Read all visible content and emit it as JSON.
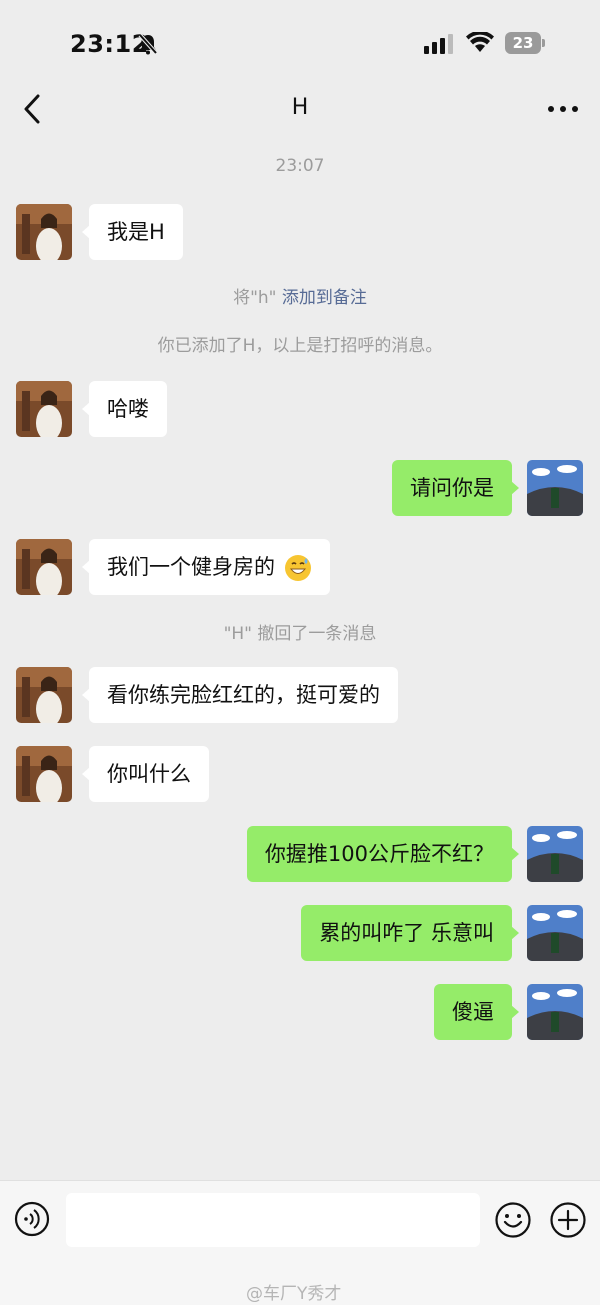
{
  "status_bar": {
    "time": "23:12",
    "battery": "23"
  },
  "header": {
    "title": "H"
  },
  "chat": {
    "timestamp": "23:07",
    "remark_prefix": "将\"h\"",
    "remark_link": "添加到备注",
    "added_notice": "你已添加了H，以上是打招呼的消息。",
    "recall_notice": "\"H\" 撤回了一条消息",
    "messages": [
      {
        "side": "in",
        "text": "我是H"
      },
      {
        "side": "in",
        "text": "哈喽"
      },
      {
        "side": "out",
        "text": "请问你是"
      },
      {
        "side": "in",
        "text": "我们一个健身房的",
        "emoji": "grinning-sweat-emoji"
      },
      {
        "side": "in",
        "text": "看你练完脸红红的，挺可爱的"
      },
      {
        "side": "in",
        "text": "你叫什么"
      },
      {
        "side": "out",
        "text": "你握推100公斤脸不红？"
      },
      {
        "side": "out",
        "text": "累的叫咋了 乐意叫"
      },
      {
        "side": "out",
        "text": "傻逼"
      }
    ]
  },
  "input": {
    "placeholder": ""
  },
  "watermark": "@车厂Y秀才",
  "colors": {
    "background": "#ededed",
    "incoming_bubble": "#ffffff",
    "outgoing_bubble": "#95ec69",
    "link": "#576b95"
  }
}
